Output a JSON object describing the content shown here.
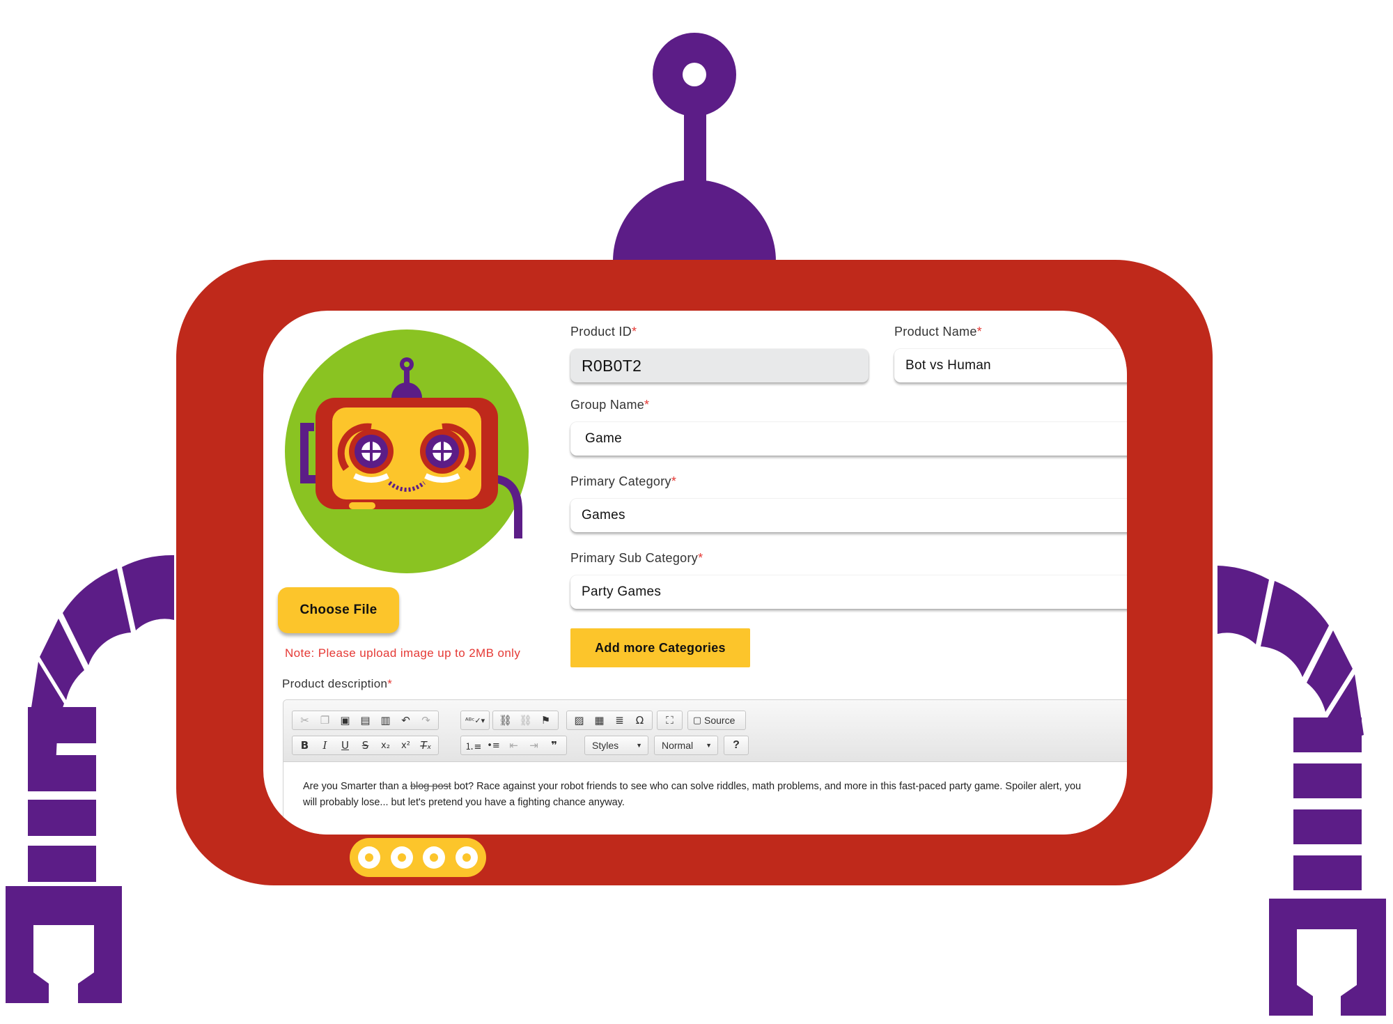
{
  "colors": {
    "robot_body": "#bf291b",
    "robot_purple": "#5c1d87",
    "accent_yellow": "#fcc52b",
    "avatar_green": "#8ac322",
    "required_red": "#e53935"
  },
  "avatar": {
    "icon": "robot-avatar-icon"
  },
  "upload": {
    "button_label": "Choose File",
    "note": "Note: Please upload image up to 2MB only"
  },
  "form": {
    "product_id": {
      "label": "Product ID",
      "required": "*",
      "value": "R0B0T2"
    },
    "product_name": {
      "label": "Product Name",
      "required": "*",
      "value": "Bot vs Human"
    },
    "group_name": {
      "label": "Group Name",
      "required": "*",
      "value": "Game"
    },
    "primary_category": {
      "label": "Primary Category",
      "required": "*",
      "value": "Games"
    },
    "primary_sub_category": {
      "label": "Primary Sub Category",
      "required": "*",
      "value": "Party Games"
    },
    "add_categories_label": "Add more Categories"
  },
  "description": {
    "label": "Product description",
    "required": "*",
    "toolbar": {
      "source_label": "Source",
      "styles_label": "Styles",
      "format_label": "Normal",
      "help_label": "?"
    },
    "text_before": "Are you Smarter than a ",
    "text_strike": "blog post",
    "text_after": " bot? Race against your robot friends to see who can solve riddles, math problems, and more in this fast-paced party game. Spoiler alert, you will probably lose... but let's pretend you have a fighting chance anyway."
  }
}
